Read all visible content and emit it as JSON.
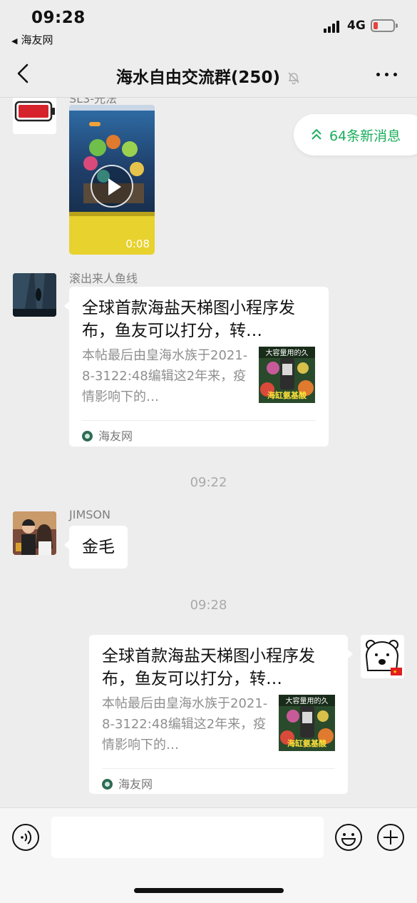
{
  "status_bar": {
    "time": "09:28",
    "back_app": "海友网",
    "network": "4G"
  },
  "nav": {
    "title": "海水自由交流群(250)",
    "icons": [
      "chevron-left-icon",
      "bell-muted-icon",
      "more-icon"
    ]
  },
  "messages": {
    "partial_sender_name": "SL3-光法",
    "video": {
      "duration": "0:08"
    },
    "msg1": {
      "sender": "滚出来人鱼线",
      "card": {
        "title": "全球首款海盐天梯图小程序发布，鱼友可以打分，转…",
        "desc": "本帖最后由皇海水族于2021-8-3122:48编辑这2年来，疫情影响下的…",
        "thumb_caption_top": "大容量用的久",
        "thumb_caption_bottom": "海缸氨基酸",
        "source": "海友网"
      }
    },
    "time_sep_1": "09:22",
    "msg2": {
      "sender": "JIMSON",
      "text": "金毛"
    },
    "time_sep_2": "09:28",
    "msg3": {
      "card": {
        "title": "全球首款海盐天梯图小程序发布，鱼友可以打分，转…",
        "desc": "本帖最后由皇海水族于2021-8-3122:48编辑这2年来，疫情影响下的…",
        "thumb_caption_top": "大容量用的久",
        "thumb_caption_bottom": "海缸氨基酸",
        "source": "海友网"
      }
    }
  },
  "new_messages": {
    "label": "64条新消息"
  },
  "input_bar": {
    "placeholder": ""
  },
  "colors": {
    "background": "#ededed",
    "accent_green": "#1aad5a",
    "battery_low": "#e64340"
  }
}
